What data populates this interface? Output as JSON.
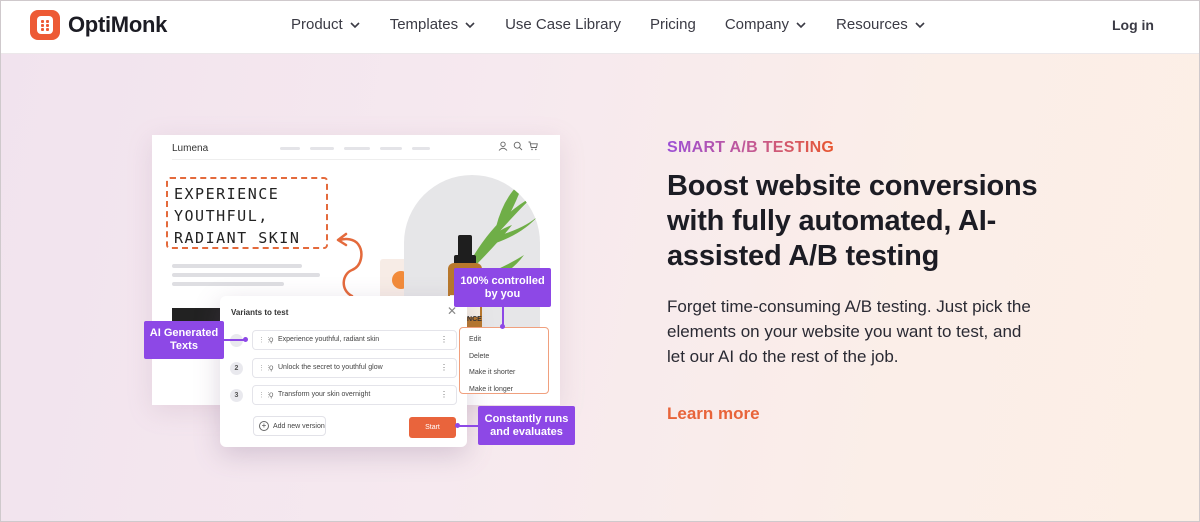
{
  "nav": {
    "brand": "OptiMonk",
    "menu": [
      {
        "label": "Product",
        "has_dropdown": true
      },
      {
        "label": "Templates",
        "has_dropdown": true
      },
      {
        "label": "Use Case Library",
        "has_dropdown": false
      },
      {
        "label": "Pricing",
        "has_dropdown": false
      },
      {
        "label": "Company",
        "has_dropdown": true
      },
      {
        "label": "Resources",
        "has_dropdown": true
      }
    ],
    "login": "Log in"
  },
  "illustration": {
    "site_brand": "Lumena",
    "headline_lines": [
      "EXPERIENCE",
      "YOUTHFUL,",
      "RADIANT SKIN"
    ],
    "product_label": "ANCE",
    "variants_panel": {
      "title": "Variants to test",
      "rows": [
        {
          "num": "",
          "text": "Experience youthful, radiant skin"
        },
        {
          "num": "2",
          "text": "Unlock the secret to youthful glow"
        },
        {
          "num": "3",
          "text": "Transform your skin overnight"
        }
      ],
      "add_label": "Add new version",
      "start_label": "Start"
    },
    "context_menu": [
      "Edit",
      "Delete",
      "Make it shorter",
      "Make it longer"
    ],
    "callouts": {
      "ai_texts": [
        "AI Generated",
        "Texts"
      ],
      "controlled": [
        "100% controlled",
        "by you"
      ],
      "runs": [
        "Constantly runs",
        "and evaluates"
      ]
    }
  },
  "hero": {
    "eyebrow": "SMART A/B TESTING",
    "heading_lines": [
      "Boost website conversions",
      "with fully automated, AI-",
      "assisted A/B testing"
    ],
    "description_lines": [
      "Forget time-consuming A/B testing. Just pick the",
      "elements on your website you want to test, and",
      "let our AI do the rest of the job."
    ],
    "cta": "Learn more"
  },
  "colors": {
    "brand_orange": "#e8643a",
    "callout_purple": "#8d48e6",
    "eyebrow_gradient": [
      "#9c4fd6",
      "#e8562e"
    ]
  }
}
